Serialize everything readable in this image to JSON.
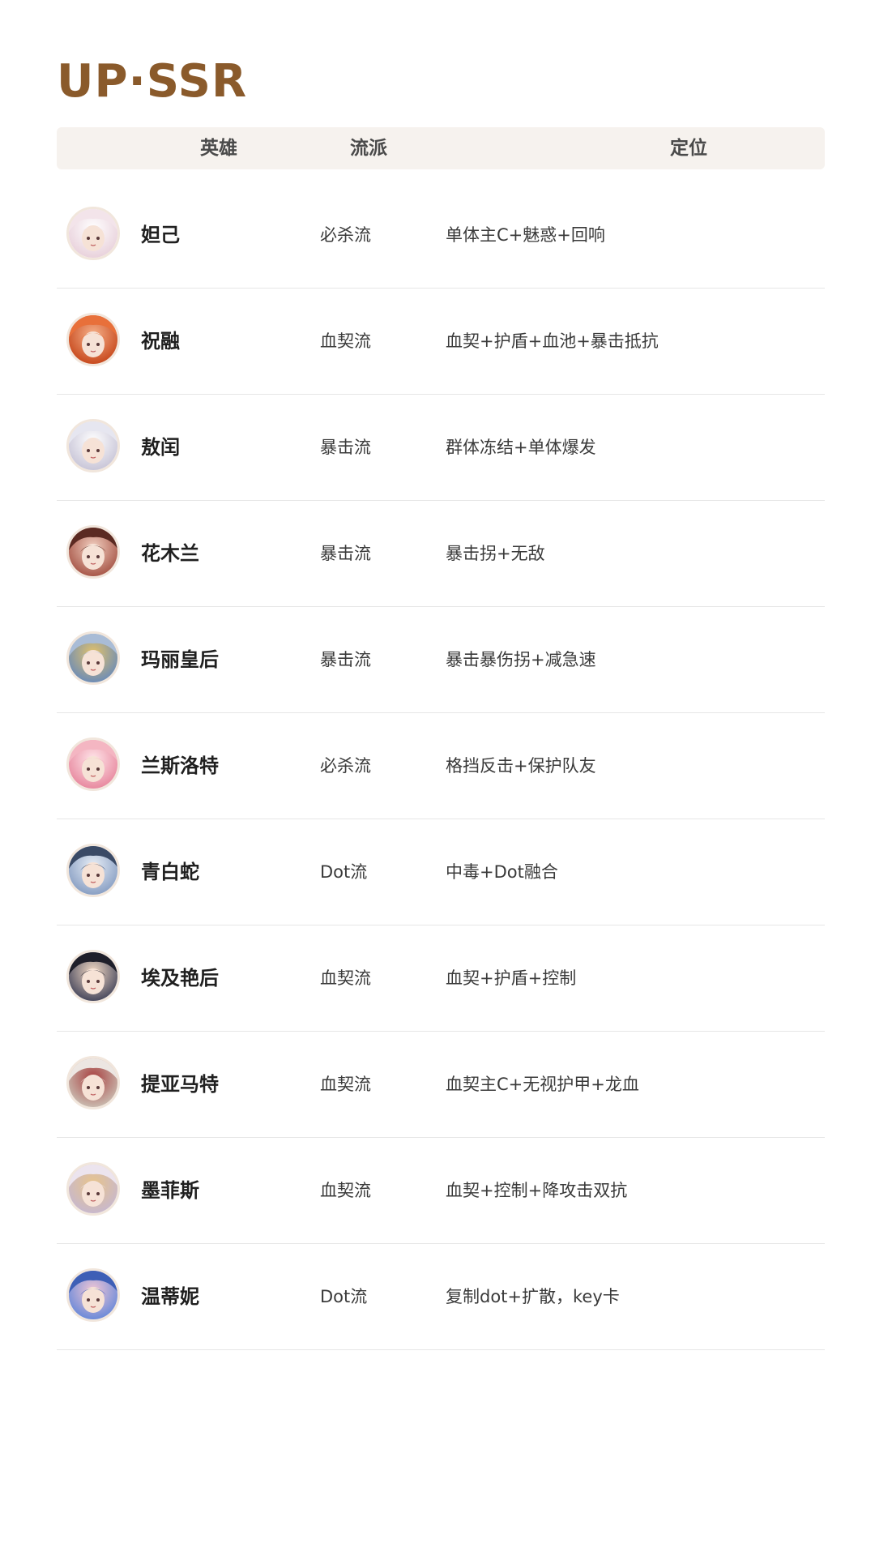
{
  "title": "UP·SSR",
  "headers": {
    "hero": "英雄",
    "school": "流派",
    "role": "定位"
  },
  "rows": [
    {
      "name": "妲己",
      "school": "必杀流",
      "role": "单体主C+魅惑+回响",
      "avatar_colors": [
        "#f3e4ea",
        "#e9d2dc",
        "#ffffff"
      ]
    },
    {
      "name": "祝融",
      "school": "血契流",
      "role": "血契+护盾+血池+暴击抵抗",
      "avatar_colors": [
        "#e8703a",
        "#c84a1e",
        "#f6b18a"
      ]
    },
    {
      "name": "敖闰",
      "school": "暴击流",
      "role": "群体冻结+单体爆发",
      "avatar_colors": [
        "#e6e6f0",
        "#c9c6d8",
        "#ffffff"
      ]
    },
    {
      "name": "花木兰",
      "school": "暴击流",
      "role": "暴击拐+无敌",
      "avatar_colors": [
        "#5b2a22",
        "#a8584a",
        "#f2cfc0"
      ]
    },
    {
      "name": "玛丽皇后",
      "school": "暴击流",
      "role": "暴击暴伤拐+减急速",
      "avatar_colors": [
        "#a9bcd6",
        "#6f8db5",
        "#e3c26a"
      ]
    },
    {
      "name": "兰斯洛特",
      "school": "必杀流",
      "role": "格挡反击+保护队友",
      "avatar_colors": [
        "#f4b6c2",
        "#e88aa0",
        "#ffe6ea"
      ]
    },
    {
      "name": "青白蛇",
      "school": "Dot流",
      "role": "中毒+Dot融合",
      "avatar_colors": [
        "#3a4a66",
        "#8aa0c4",
        "#e8eef6"
      ]
    },
    {
      "name": "埃及艳后",
      "school": "血契流",
      "role": "血契+护盾+控制",
      "avatar_colors": [
        "#1f1f2a",
        "#4a4a5e",
        "#f2d9c4"
      ]
    },
    {
      "name": "提亚马特",
      "school": "血契流",
      "role": "血契主C+无视护甲+龙血",
      "avatar_colors": [
        "#ece6e2",
        "#c9b9ae",
        "#a84040"
      ]
    },
    {
      "name": "墨菲斯",
      "school": "血契流",
      "role": "血契+控制+降攻击双抗",
      "avatar_colors": [
        "#ece4ee",
        "#c8b8cc",
        "#e8c48a"
      ]
    },
    {
      "name": "温蒂妮",
      "school": "Dot流",
      "role": "复制dot+扩散，key卡",
      "avatar_colors": [
        "#3e5fb6",
        "#6c8ad8",
        "#f1c7d6"
      ]
    }
  ]
}
